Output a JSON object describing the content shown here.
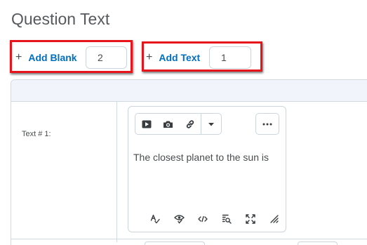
{
  "section": {
    "title": "Question Text"
  },
  "add_blank": {
    "plus": "+",
    "label": "Add Blank",
    "count": "2"
  },
  "add_text": {
    "plus": "+",
    "label": "Add Text",
    "count": "1"
  },
  "table": {
    "rows": [
      {
        "label": "Text # 1:",
        "content": "The closest planet to the sun is"
      }
    ]
  },
  "editor": {
    "toolbar_icons": [
      "video-icon",
      "camera-icon",
      "link-icon",
      "chevron-down-icon",
      "more-options-icon"
    ],
    "status_icons": [
      "spellcheck-icon",
      "accessibility-check-icon",
      "source-code-icon",
      "find-replace-icon",
      "fullscreen-icon",
      "resize-handle-icon"
    ]
  },
  "colors": {
    "link": "#006fbf",
    "highlight": "#e8141c",
    "text": "#494c4e",
    "header_bg": "#f1f5fb"
  }
}
